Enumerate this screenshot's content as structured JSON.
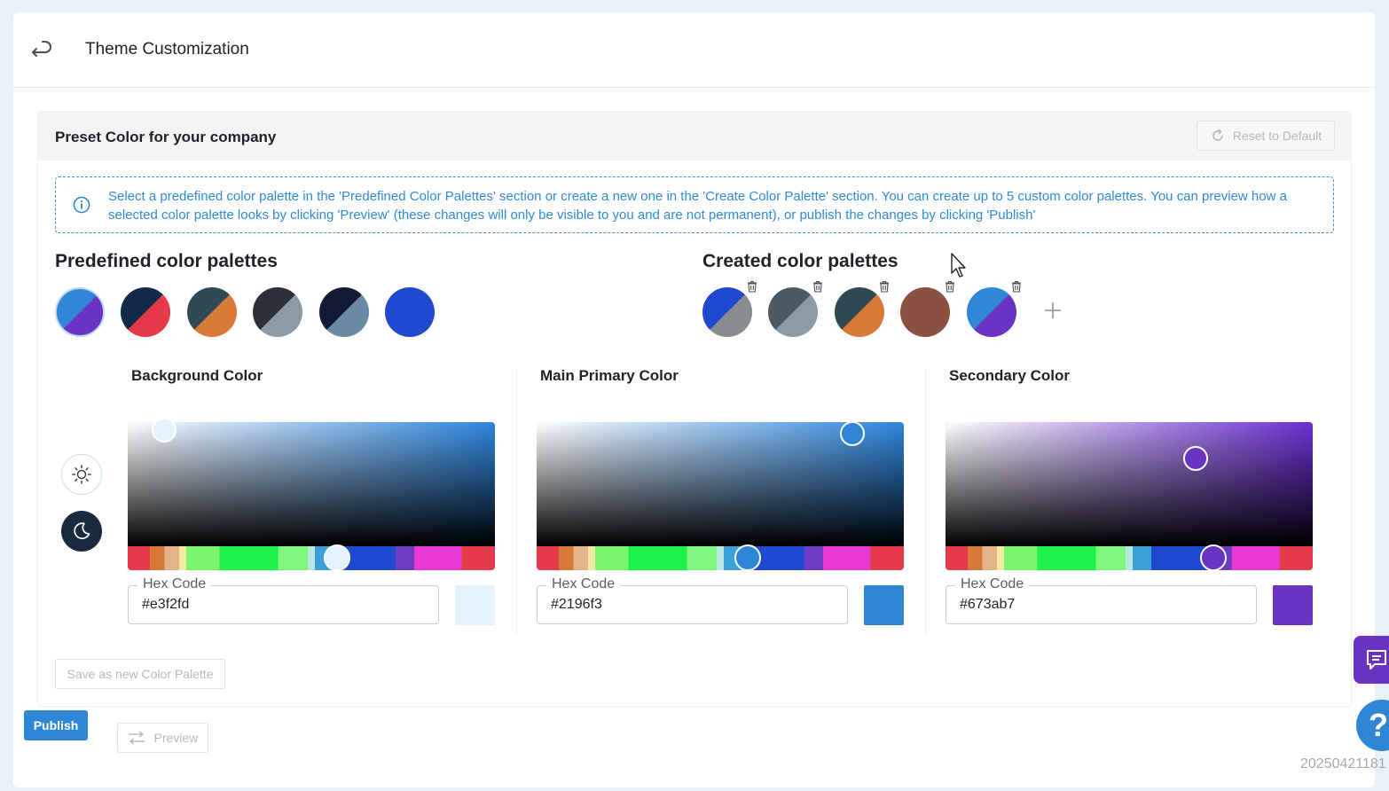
{
  "page": {
    "title": "Theme Customization"
  },
  "panel": {
    "title": "Preset Color for your company",
    "reset_label": "Reset to Default",
    "info_text": "Select a predefined color palette in the 'Predefined Color Palettes' section or create a new one in the 'Create Color Palette' section. You can create up to 5 custom color palettes. You can preview how a selected color palette looks by clicking 'Preview' (these changes will only be visible to you and are not permanent), or publish the changes by clicking 'Publish'"
  },
  "predefined": {
    "title": "Predefined color palettes",
    "palettes": [
      {
        "primary": "#2f86d6",
        "secondary": "#6a33c2",
        "selected": true
      },
      {
        "primary": "#0f2a4a",
        "secondary": "#e53a4a"
      },
      {
        "primary": "#2f4a52",
        "secondary": "#d87a38"
      },
      {
        "primary": "#2b3137",
        "secondary": "#8d9aa6"
      },
      {
        "primary": "#141a36",
        "secondary": "#6a8aa4"
      },
      {
        "primary": "#1f49cf",
        "secondary": "#1f49cf"
      }
    ]
  },
  "created": {
    "title": "Created color palettes",
    "palettes": [
      {
        "primary": "#1f49cf",
        "secondary": "#8a8d90"
      },
      {
        "primary": "#4b5a62",
        "secondary": "#8d9aa6"
      },
      {
        "primary": "#2f4a52",
        "secondary": "#d87a38"
      },
      {
        "primary": "#8a5040",
        "secondary": "#8a5040"
      },
      {
        "primary": "#2f86d6",
        "secondary": "#6a33c2"
      }
    ]
  },
  "pickers": [
    {
      "label": "Background Color",
      "hex_label": "Hex Code",
      "hex_value": "#e3f2fd",
      "preview": "#e3f2fd",
      "base_hue": "#2e86de"
    },
    {
      "label": "Main Primary Color",
      "hex_label": "Hex Code",
      "hex_value": "#2196f3",
      "preview": "#2f86d6",
      "base_hue": "#2e86de"
    },
    {
      "label": "Secondary Color",
      "hex_label": "Hex Code",
      "hex_value": "#673ab7",
      "preview": "#6a33c2",
      "base_hue": "#6a2fd0"
    }
  ],
  "modes": {
    "light_icon": "sun-icon",
    "dark_icon": "moon-icon"
  },
  "actions": {
    "save_palette_label": "Save as new Color Palette",
    "publish_label": "Publish",
    "preview_label": "Preview"
  },
  "help_label": "?",
  "timestamp": "20250421181"
}
